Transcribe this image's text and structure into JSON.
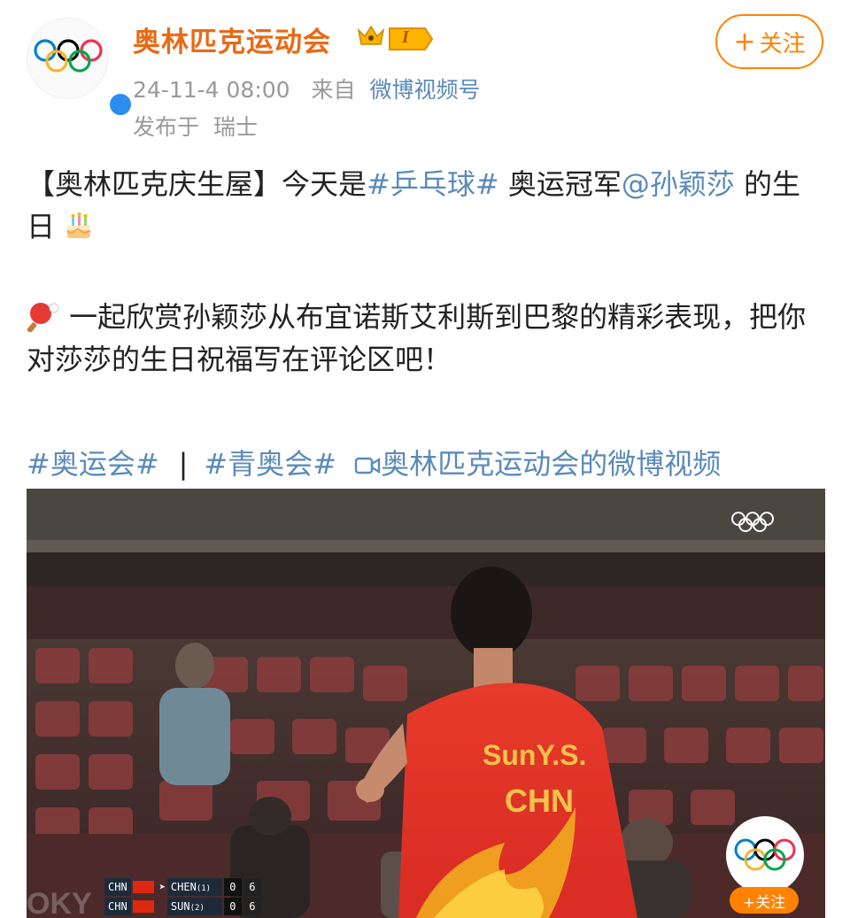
{
  "author": {
    "name": "奥林匹克运动会",
    "level_badge": "I",
    "verified": true
  },
  "post_meta": {
    "time": "24-11-4 08:00",
    "from_label": "来自",
    "source": "微博视频号",
    "location_prefix": "发布于",
    "location": "瑞士"
  },
  "follow_button": {
    "plus": "+",
    "label": "关注"
  },
  "content": {
    "p1_a": "【奥林匹克庆生屋】今天是",
    "p1_topic": "#乒乓球#",
    "p1_b": " 奥运冠军",
    "p1_mention": "@孙颖莎",
    "p1_c": " 的生日",
    "p1_emoji": "birthday-cake",
    "p2_emoji": "ping-pong",
    "p2_text": " 一起欣赏孙颖莎从布宜诺斯艾利斯到巴黎的精彩表现，把你对莎莎的生日祝福写在评论区吧！",
    "tag1": "#奥运会#",
    "separator": "|",
    "tag2": "#青奥会#",
    "video_link": "奥林匹克运动会的微博视频"
  },
  "video": {
    "jersey_name": "SunY.S.",
    "jersey_country": "CHN",
    "scoreboard": [
      {
        "country": "CHN",
        "player": "CHEN",
        "seed": "(1)",
        "games": "0",
        "points": "6",
        "serving": true
      },
      {
        "country": "CHN",
        "player": "SUN",
        "seed": "(2)",
        "games": "0",
        "points": "6",
        "serving": false
      }
    ],
    "watermark_text": "OKY",
    "mini_follow": "+关注"
  },
  "colors": {
    "author_name": "#e86a15",
    "follow": "#ff8200",
    "link": "#5b8ab9",
    "meta": "#999999",
    "verified": "#2d8cf0"
  }
}
